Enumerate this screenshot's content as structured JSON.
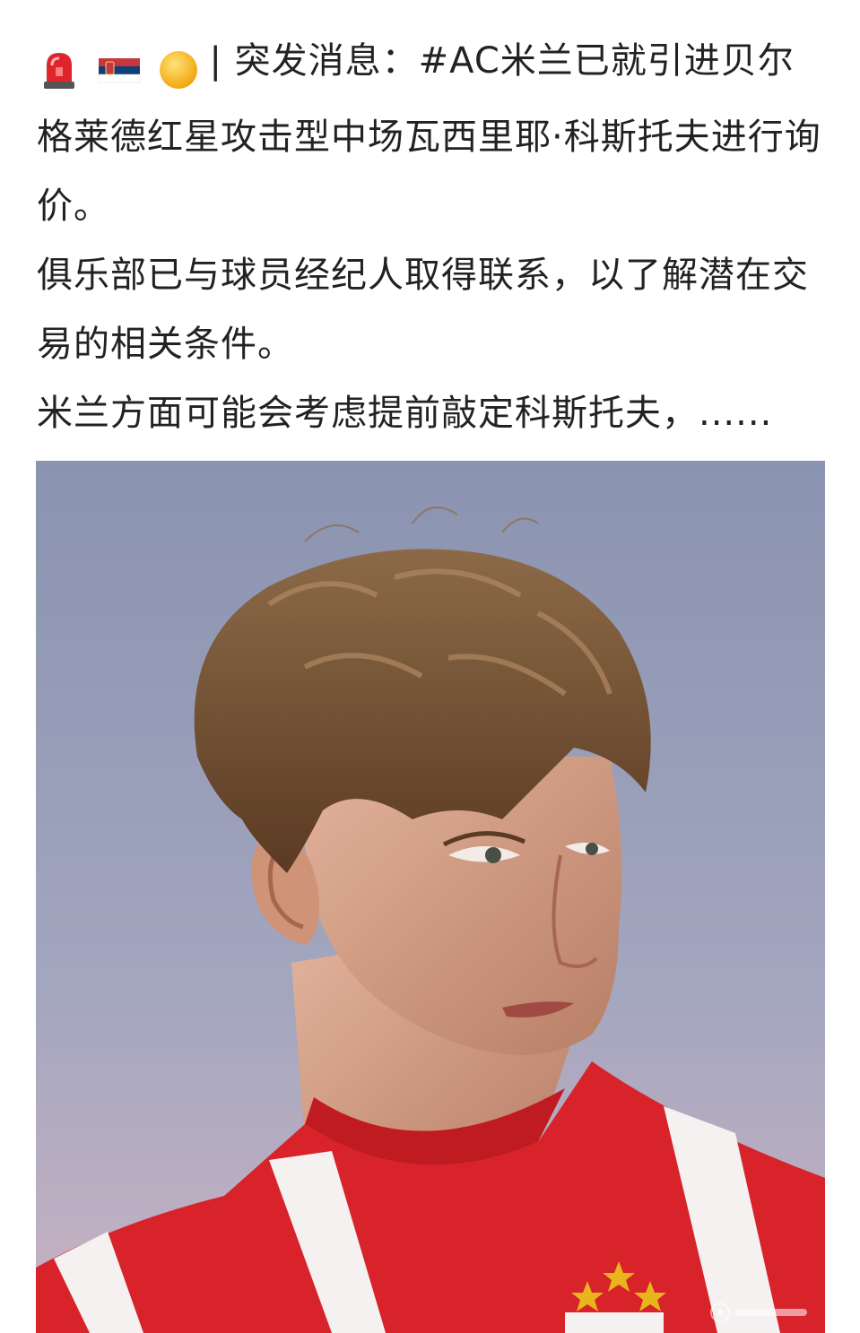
{
  "post": {
    "emojis": [
      "police-light-icon",
      "serbia-flag-icon",
      "orange-ball-icon"
    ],
    "separator": "|",
    "headline": "突发消息：#AC米兰已就引进贝尔格莱德红星攻击型中场瓦西里耶·科斯托夫进行询价。",
    "paragraph2": "俱乐部已与球员经纪人取得联系，以了解潜在交易的相关条件。",
    "paragraph3_prefix": "米兰方面可能会考虑提前敲定科斯托夫，",
    "more_label": "......"
  },
  "photo": {
    "subject": "player-portrait-image",
    "colors": {
      "sky_top": "#8a93b0",
      "sky_bottom": "#c9b3c3",
      "jersey_red": "#d8232a",
      "jersey_white": "#f4f1f0",
      "hair": "#7a5130",
      "skin": "#d9a48a",
      "star": "#e8b51c"
    }
  }
}
